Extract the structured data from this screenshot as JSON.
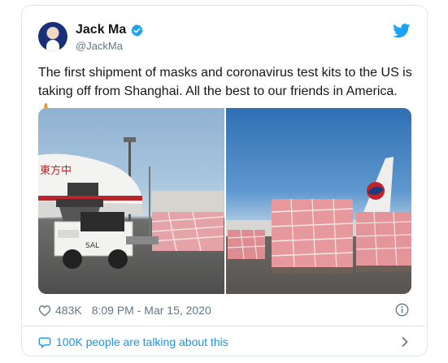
{
  "tweet": {
    "author_name": "Jack Ma",
    "author_handle": "@JackMa",
    "text": "The first shipment of masks and coronavirus test kits to the US is taking off from Shanghai. All the best to our friends in America.",
    "emoji": "🙏",
    "likes": "483K",
    "timestamp": "8:09 PM - Mar 15, 2020",
    "conversation_text": "100K people are talking about this"
  },
  "icons": {
    "verified": "verified-badge-icon",
    "brand": "twitter-bird-icon",
    "like": "heart-icon",
    "info": "info-icon",
    "conversation": "speech-bubble-icon",
    "chevron": "chevron-right-icon"
  },
  "photos": {
    "left_plane_text": "東方中"
  },
  "colors": {
    "twitter_blue": "#1da1f2",
    "link_blue": "#1b95e0",
    "muted": "#657786",
    "text": "#14171a",
    "border": "#e1e8ed"
  }
}
